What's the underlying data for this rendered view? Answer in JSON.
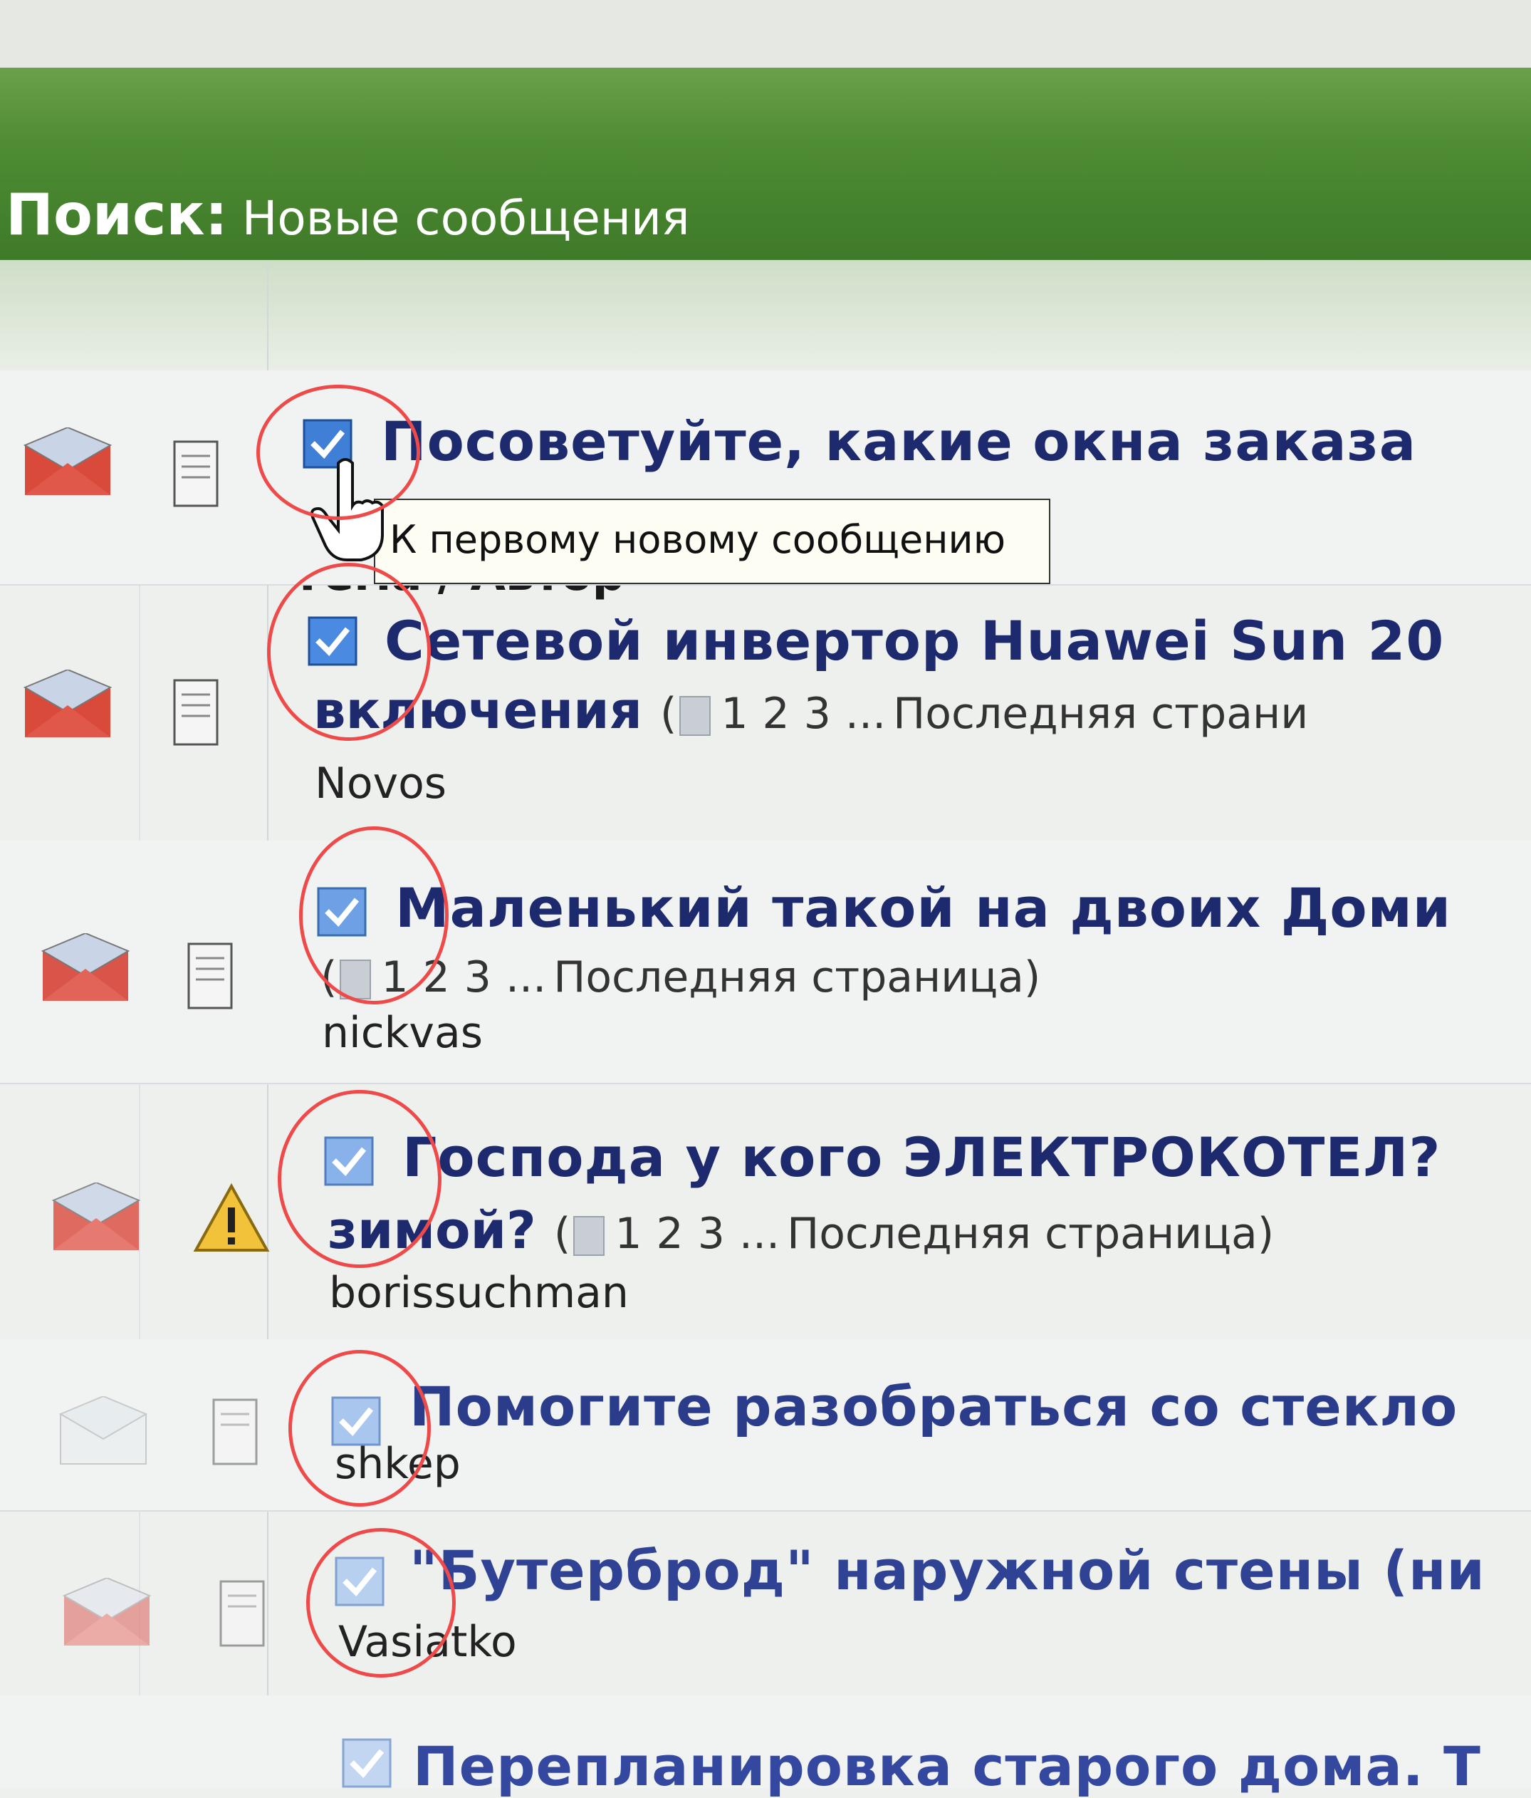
{
  "header": {
    "label": "Поиск:",
    "query": "Новые сообщения"
  },
  "column": {
    "title": "Тема / Автор"
  },
  "tooltip": {
    "text": "К первому новому сообщению"
  },
  "rows": [
    {
      "title": "Посоветуйте, какие окна заказа",
      "author": "",
      "icon": "doc"
    },
    {
      "title": "Сетевой инвертор Huawei Sun 20",
      "title2": "включения",
      "pages_last": "Последняя страни",
      "author": "Novos",
      "icon": "doc"
    },
    {
      "title": "Маленький такой на двоих Доми",
      "pages_last": "Последняя страница",
      "author": "nickvas",
      "icon": "doc"
    },
    {
      "title": "Господа у кого ЭЛЕКТРОКОТЕЛ?",
      "title2": "зимой?",
      "pages_last": "Последняя страница",
      "author": "borissuchman",
      "icon": "warning"
    },
    {
      "title": "Помогите разобраться со стекло",
      "author": "shkep",
      "icon": "doc"
    },
    {
      "title": "\"Бутерброд\" наружной стены (ни",
      "author": "Vasiatko",
      "icon": "doc"
    },
    {
      "title": "Перепланировка старого дома. Т",
      "author": "",
      "icon": "doc"
    }
  ],
  "pagination": {
    "p1": "1",
    "p2": "2",
    "p3": "3",
    "ellipsis": "..."
  },
  "colors": {
    "header_green": "#4f8c34",
    "title_blue": "#1e2a6e",
    "annotation_red": "#ee4a4a"
  }
}
